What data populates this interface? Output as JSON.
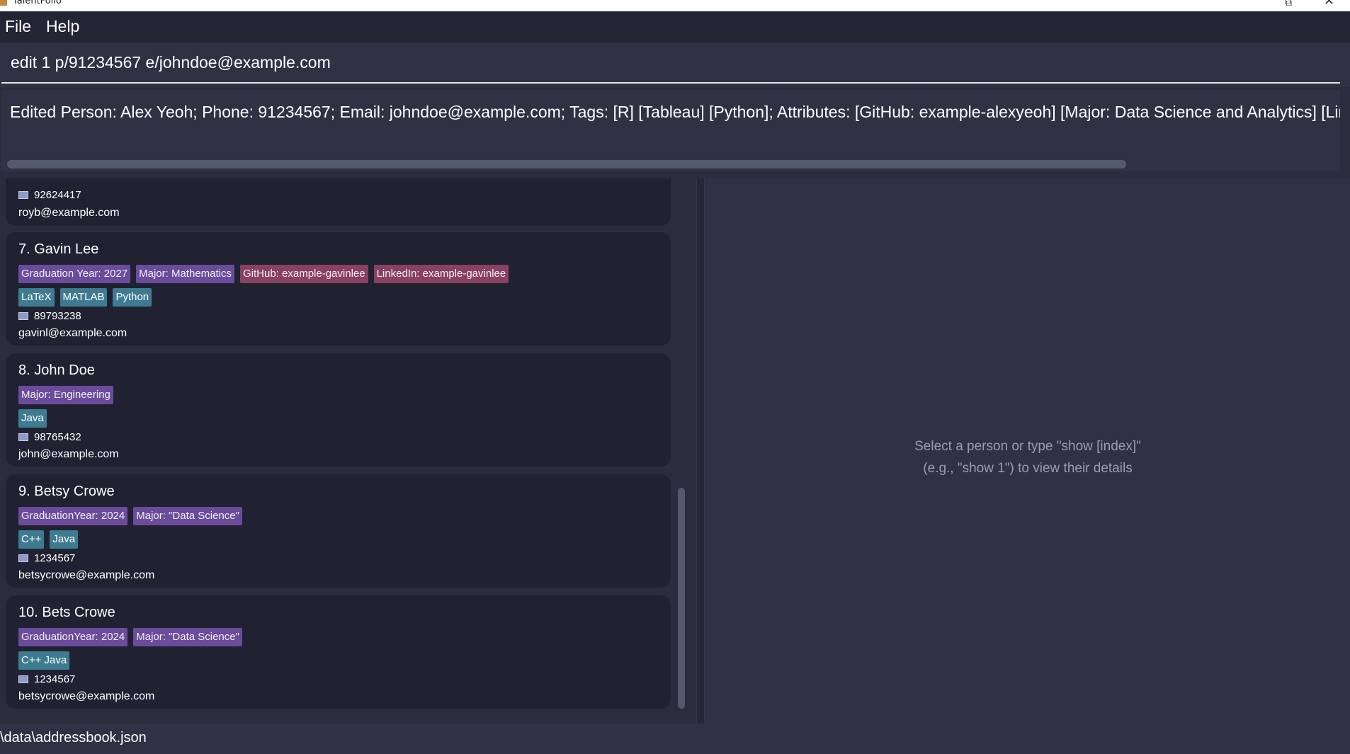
{
  "window": {
    "title": "TalentFolio",
    "app_icon": "app-icon",
    "restore_glyph": "⧉",
    "close_glyph": "✕"
  },
  "menu": {
    "file_label": "File",
    "help_label": "Help"
  },
  "command": {
    "value": "edit 1 p/91234567 e/johndoe@example.com"
  },
  "result": {
    "text": "Edited Person: Alex Yeoh; Phone: 91234567; Email: johndoe@example.com; Tags: [R] [Tableau] [Python]; Attributes: [GitHub: example-alexyeoh] [Major: Data Science and Analytics] [LinkedIn: example-alexyeoh]"
  },
  "colors": {
    "attribute_purple": "#6a4b9c",
    "attribute_pink": "#8a4063",
    "tag_teal": "#3e7b91"
  },
  "persons": [
    {
      "name": "",
      "attributes": [],
      "tags": [],
      "phone": "92624417",
      "email": "royb@example.com"
    },
    {
      "name": "7. Gavin Lee",
      "attributes": [
        {
          "label": "Graduation Year: 2027",
          "color": "#6a4b9c"
        },
        {
          "label": "Major: Mathematics",
          "color": "#6a4b9c"
        },
        {
          "label": "GitHub: example-gavinlee",
          "color": "#8a4063"
        },
        {
          "label": "LinkedIn: example-gavinlee",
          "color": "#8a4063"
        }
      ],
      "tags": [
        "LaTeX",
        "MATLAB",
        "Python"
      ],
      "phone": "89793238",
      "email": "gavinl@example.com"
    },
    {
      "name": "8. John Doe",
      "attributes": [
        {
          "label": "Major: Engineering",
          "color": "#6a4b9c"
        }
      ],
      "tags": [
        "Java"
      ],
      "phone": "98765432",
      "email": "john@example.com"
    },
    {
      "name": "9. Betsy Crowe",
      "attributes": [
        {
          "label": "GraduationYear: 2024",
          "color": "#6a4b9c"
        },
        {
          "label": "Major: \"Data Science\"",
          "color": "#6a4b9c"
        }
      ],
      "tags": [
        "C++",
        "Java"
      ],
      "phone": "1234567",
      "email": "betsycrowe@example.com"
    },
    {
      "name": "10. Bets Crowe",
      "attributes": [
        {
          "label": "GraduationYear: 2024",
          "color": "#6a4b9c"
        },
        {
          "label": "Major: \"Data Science\"",
          "color": "#6a4b9c"
        }
      ],
      "tags": [
        "C++ Java"
      ],
      "phone": "1234567",
      "email": "betsycrowe@example.com"
    }
  ],
  "detail": {
    "placeholder_line1": "Select a person or type \"show [index]\"",
    "placeholder_line2": "(e.g., \"show 1\") to view their details"
  },
  "status": {
    "path": "\\data\\addressbook.json"
  }
}
